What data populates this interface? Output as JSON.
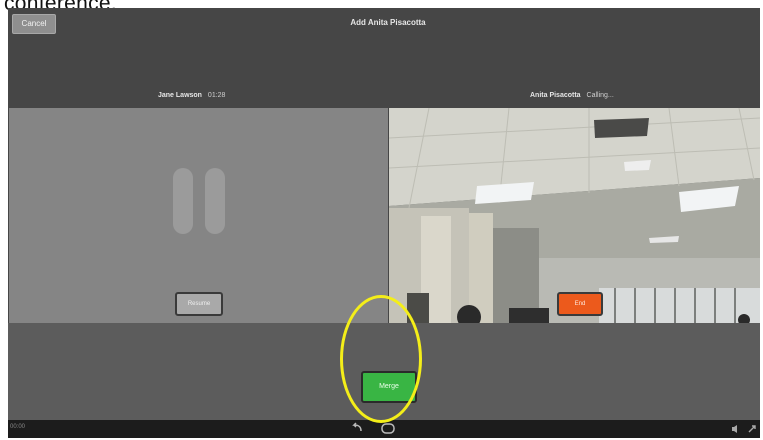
{
  "caption": "conference.",
  "topbar": {
    "cancel_label": "Cancel",
    "title": "Add Anita Pisacotta"
  },
  "left_call": {
    "name": "Jane Lawson",
    "time": "01:28",
    "resume_label": "Resume"
  },
  "right_call": {
    "name": "Anita Pisacotta",
    "status": "Calling...",
    "end_label": "End"
  },
  "merge_label": "Merge",
  "statusbar": {
    "time": "00:00"
  },
  "colors": {
    "merge": "#39b544",
    "end": "#ec5a1c",
    "highlight": "#f4ee19",
    "background": "#464646"
  },
  "icons": [
    "pause-icon",
    "back-icon",
    "home-icon",
    "volume-icon",
    "expand-icon"
  ]
}
